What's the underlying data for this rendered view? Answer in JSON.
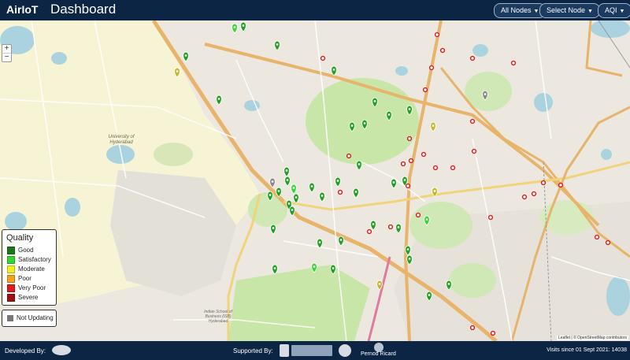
{
  "header": {
    "brand": "AirIoT",
    "title": "Dashboard",
    "buttons": [
      {
        "label": "All Nodes"
      },
      {
        "label": "Select Node"
      },
      {
        "label": "AQI"
      }
    ]
  },
  "map": {
    "zoom_in": "+",
    "zoom_out": "−",
    "labels": {
      "university": "University of Hyderabad",
      "school": "Indian School of Business (ISB) Hyderabad"
    },
    "attribution": "Leaflet | © OpenStreetMap contributors",
    "scale": "500 m"
  },
  "legend": {
    "title": "Quality",
    "items": [
      {
        "label": "Good",
        "color": "#1a7a1a"
      },
      {
        "label": "Satisfactory",
        "color": "#33d633"
      },
      {
        "label": "Moderate",
        "color": "#f0f020"
      },
      {
        "label": "Poor",
        "color": "#f7a21b"
      },
      {
        "label": "Very Poor",
        "color": "#e21a1a"
      },
      {
        "label": "Severe",
        "color": "#a01010"
      }
    ],
    "not_updating": {
      "label": "Not Updating",
      "color": "#777777"
    }
  },
  "footer": {
    "developed_by": "Developed By:",
    "supported_by": "Supported By:",
    "sponsor_text": "Pernod Ricard",
    "visits": "Visits since 01 Sept 2021: 14038"
  },
  "markers": {
    "colors": {
      "green": "#1fa11f",
      "lime": "#33d633",
      "olive": "#c4b82a",
      "gray": "#888888",
      "red": "#d11a1a"
    }
  }
}
